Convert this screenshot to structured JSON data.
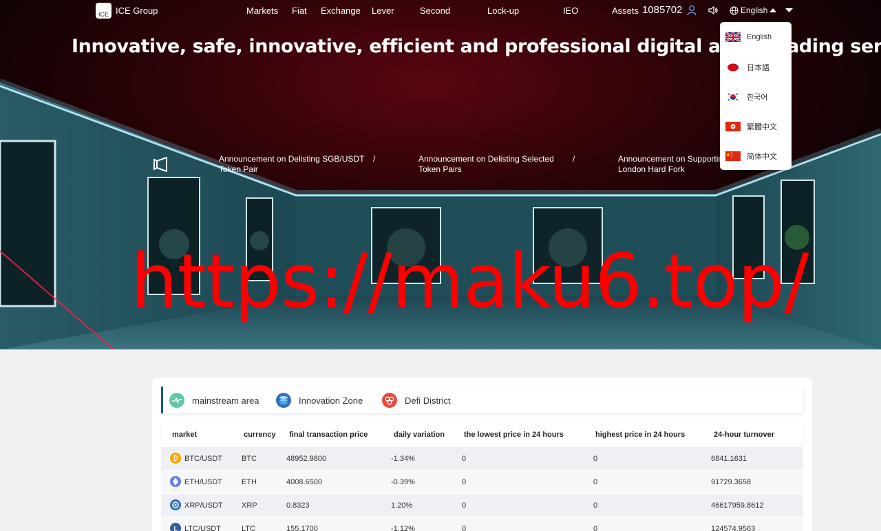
{
  "nav": {
    "brand": "ICE Group",
    "logo_text": "ICE",
    "items": [
      "Markets",
      "Fiat",
      "Exchange",
      "Lever",
      "Second",
      "Lock-up",
      "IEO"
    ],
    "assets_label": "Assets",
    "assets_value": "1085702",
    "language": "English"
  },
  "hero": {
    "headline": "Innovative, safe, innovative, efficient and professional digital asset trading service platform",
    "announcements": [
      "Announcement on Delisting SGB/USDT Token Pair",
      "Announcement on Delisting Selected Token Pairs",
      "Announcement on Supporting London Hard Fork"
    ],
    "separator": "/",
    "watermark": "https://maku6.top/"
  },
  "languages": [
    "English",
    "日本語",
    "한국어",
    "繁體中文",
    "简体中文"
  ],
  "market": {
    "tabs": [
      "mainstream area",
      "Innovation Zone",
      "Defi District"
    ],
    "columns": [
      "market",
      "currency",
      "final transaction price",
      "daily variation",
      "the lowest price in 24 hours",
      "highest price in 24 hours",
      "24-hour turnover"
    ],
    "rows": [
      {
        "market": "BTC/USDT",
        "currency": "BTC",
        "price": "48952.9800",
        "change": "-1.34%",
        "low": "0",
        "high": "0",
        "turnover": "6841.1631"
      },
      {
        "market": "ETH/USDT",
        "currency": "ETH",
        "price": "4008.6500",
        "change": "-0.39%",
        "low": "0",
        "high": "0",
        "turnover": "91729.3658"
      },
      {
        "market": "XRP/USDT",
        "currency": "XRP",
        "price": "0.8323",
        "change": "1.20%",
        "low": "0",
        "high": "0",
        "turnover": "46617959.8612"
      },
      {
        "market": "LTC/USDT",
        "currency": "LTC",
        "price": "155.1700",
        "change": "-1.12%",
        "low": "0",
        "high": "0",
        "turnover": "124574.9563"
      }
    ]
  },
  "colors": {
    "accent": "#1f4fa0",
    "watermark": "#ff0000",
    "btc": "#f7a600",
    "eth": "#627eea",
    "xrp": "#2a73c8",
    "ltc": "#345d9d"
  }
}
